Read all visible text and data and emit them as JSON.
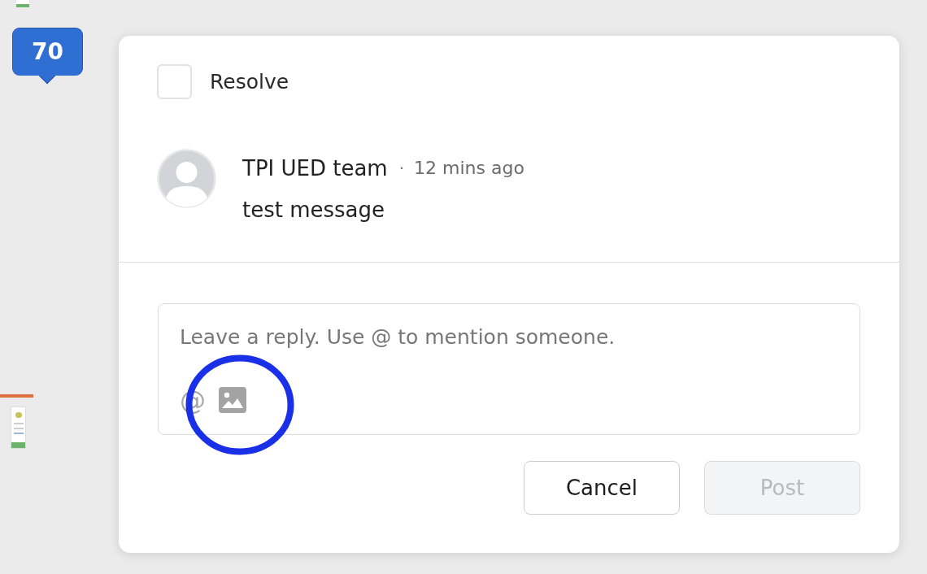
{
  "canvas": {
    "marker": {
      "label": "70"
    }
  },
  "comment_panel": {
    "resolve": {
      "label": "Resolve",
      "checked": false
    },
    "comment": {
      "author": "TPI UED team",
      "separator": "·",
      "time": "12 mins ago",
      "message": "test message"
    },
    "reply": {
      "placeholder": "Leave a reply. Use @ to mention someone.",
      "tools": [
        {
          "kind": "mention",
          "label": "@"
        },
        {
          "kind": "image"
        }
      ]
    },
    "buttons": [
      {
        "label": "Cancel",
        "disabled": false
      },
      {
        "label": "Post",
        "disabled": true
      }
    ]
  }
}
